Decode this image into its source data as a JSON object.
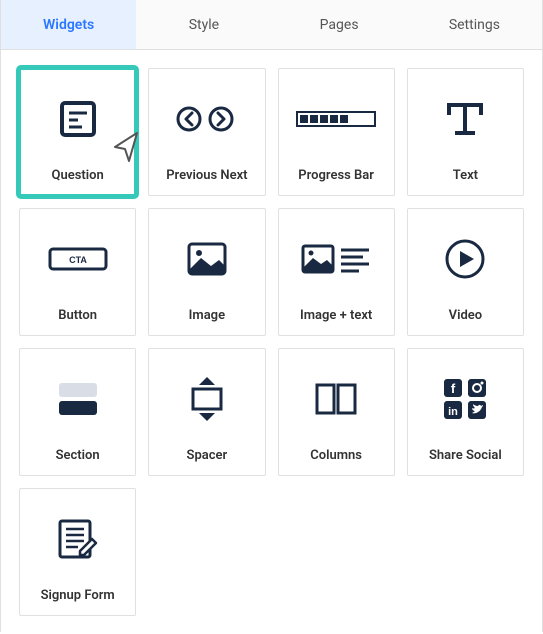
{
  "tabs": [
    {
      "label": "Widgets",
      "active": true
    },
    {
      "label": "Style",
      "active": false
    },
    {
      "label": "Pages",
      "active": false
    },
    {
      "label": "Settings",
      "active": false
    }
  ],
  "widgets": [
    {
      "key": "question",
      "label": "Question",
      "icon": "question-icon",
      "highlight": true
    },
    {
      "key": "previous-next",
      "label": "Previous Next",
      "icon": "prev-next-icon",
      "highlight": false
    },
    {
      "key": "progress-bar",
      "label": "Progress Bar",
      "icon": "progress-bar-icon",
      "highlight": false
    },
    {
      "key": "text",
      "label": "Text",
      "icon": "text-icon",
      "highlight": false
    },
    {
      "key": "button",
      "label": "Button",
      "icon": "button-cta-icon",
      "highlight": false
    },
    {
      "key": "image",
      "label": "Image",
      "icon": "image-icon",
      "highlight": false
    },
    {
      "key": "image-text",
      "label": "Image + text",
      "icon": "image-text-icon",
      "highlight": false
    },
    {
      "key": "video",
      "label": "Video",
      "icon": "video-icon",
      "highlight": false
    },
    {
      "key": "section",
      "label": "Section",
      "icon": "section-icon",
      "highlight": false
    },
    {
      "key": "spacer",
      "label": "Spacer",
      "icon": "spacer-icon",
      "highlight": false
    },
    {
      "key": "columns",
      "label": "Columns",
      "icon": "columns-icon",
      "highlight": false
    },
    {
      "key": "share-social",
      "label": "Share Social",
      "icon": "share-social-icon",
      "highlight": false
    },
    {
      "key": "signup-form",
      "label": "Signup Form",
      "icon": "signup-form-icon",
      "highlight": false
    }
  ],
  "colors": {
    "highlight": "#35c9ba",
    "tab_active_bg": "#e6f0ff",
    "tab_active_fg": "#2b77ff",
    "icon": "#1a2942"
  }
}
